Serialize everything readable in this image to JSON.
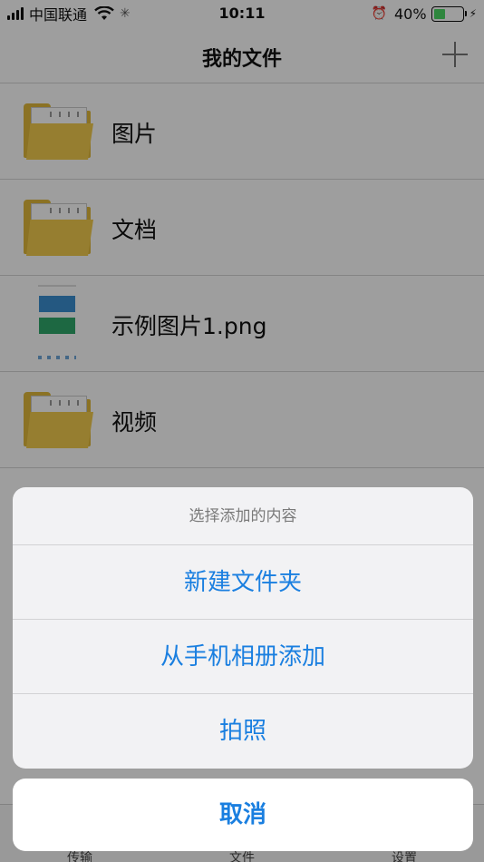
{
  "status_bar": {
    "carrier": "中国联通",
    "time": "10:11",
    "battery_percent": "40%",
    "battery_level": 0.4,
    "icons": [
      "signal-icon",
      "wifi-icon",
      "loading-icon",
      "alarm-icon",
      "battery-icon",
      "charging-icon"
    ]
  },
  "nav": {
    "title": "我的文件",
    "add_icon": "plus-icon"
  },
  "files": [
    {
      "name": "图片",
      "icon": "folder-icon"
    },
    {
      "name": "文档",
      "icon": "folder-icon"
    },
    {
      "name": "示例图片1.png",
      "icon": "image-thumbnail"
    },
    {
      "name": "视频",
      "icon": "folder-icon"
    }
  ],
  "tab_bar": {
    "tabs": [
      "传输",
      "文件",
      "设置"
    ]
  },
  "action_sheet": {
    "title": "选择添加的内容",
    "options": [
      "新建文件夹",
      "从手机相册添加",
      "拍照"
    ],
    "cancel": "取消"
  },
  "colors": {
    "accent": "#1a7fe0",
    "folder": "#e0b83a",
    "battery": "#4cd964"
  }
}
